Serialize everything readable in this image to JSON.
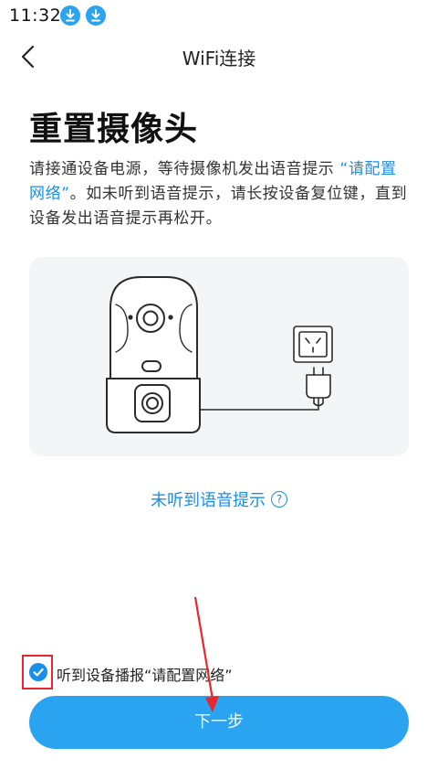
{
  "status_bar": {
    "time": "11:32",
    "icons": [
      "download-icon",
      "download-icon"
    ]
  },
  "header": {
    "title": "WiFi连接",
    "back_icon": "chevron-left-icon"
  },
  "content": {
    "title": "重置摄像头",
    "instruction_part1": "请接通设备电源，等待摄像机发出语音提示 ",
    "instruction_highlight": "“请配置网络”",
    "instruction_part2": "。如未听到语音提示，请长按设备复位键，直到设备发出语音提示再松开。",
    "illustration": {
      "camera": "camera-icon",
      "outlet": "power-outlet-icon",
      "plug": "power-plug-icon"
    }
  },
  "help_link": {
    "label": "未听到语音提示",
    "icon": "question-circle-icon"
  },
  "confirm": {
    "checked": true,
    "label": "听到设备播报“请配置网络”"
  },
  "next_button": {
    "label": "下一步"
  },
  "colors": {
    "accent": "#2aa3f0",
    "link": "#1a8fe8",
    "annotation": "#e8262b"
  }
}
